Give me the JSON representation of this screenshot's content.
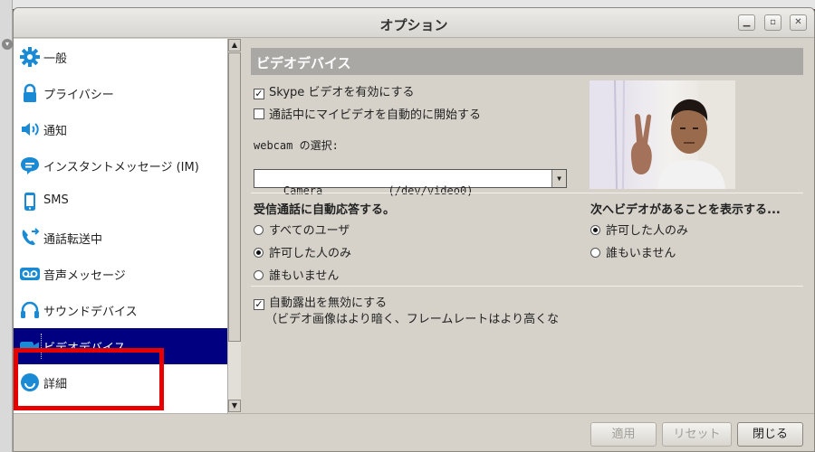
{
  "window": {
    "title": "オプション"
  },
  "sidebar": {
    "items": [
      {
        "label": "一般",
        "icon": "gear-icon"
      },
      {
        "label": "プライバシー",
        "icon": "lock-icon"
      },
      {
        "label": "通知",
        "icon": "speaker-icon"
      },
      {
        "label": "インスタントメッセージ (IM)",
        "icon": "chat-bubble-icon"
      },
      {
        "label": "SMS",
        "icon": "mobile-phone-icon"
      },
      {
        "label": "通話転送中",
        "icon": "call-forward-icon"
      },
      {
        "label": "音声メッセージ",
        "icon": "voicemail-icon"
      },
      {
        "label": "サウンドデバイス",
        "icon": "headset-icon"
      },
      {
        "label": "ビデオデバイス",
        "icon": "video-camera-icon",
        "selected": true
      },
      {
        "label": "詳細",
        "icon": "smiley-icon"
      }
    ]
  },
  "video": {
    "section_title": "ビデオデバイス",
    "enable_video_label": "Skype ビデオを有効にする",
    "enable_video_checked": true,
    "auto_start_label": "通話中にマイビデオを自動的に開始する",
    "auto_start_checked": false,
    "webcam_select_label": "webcam の選択:",
    "webcam_selected": "Camera          (/dev/video0)",
    "auto_answer_heading": "受信通話に自動応答する。",
    "auto_answer_options": [
      "すべてのユーザ",
      "許可した人のみ",
      "誰もいません"
    ],
    "auto_answer_selected": 1,
    "show_video_heading": "次へビデオがあることを表示する...",
    "show_video_options": [
      "許可した人のみ",
      "誰もいません"
    ],
    "show_video_selected": 0,
    "disable_exposure_label": "自動露出を無効にする",
    "disable_exposure_checked": true,
    "disable_exposure_note": "（ビデオ画像はより暗く、フレームレートはより高くな"
  },
  "buttons": {
    "apply": "適用",
    "reset": "リセット",
    "close": "閉じる"
  },
  "colors": {
    "selected_bg": "#000080",
    "highlight_box": "#e60000",
    "section_head_bg": "#a9a8a5",
    "icon_blue": "#1a8ad4"
  }
}
